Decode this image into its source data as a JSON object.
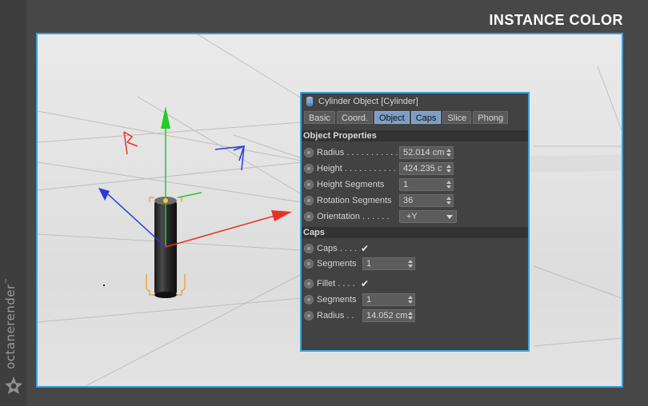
{
  "title": "INSTANCE COLOR",
  "brand": {
    "text": "octanerender",
    "mark": "™"
  },
  "panel": {
    "header": "Cylinder Object [Cylinder]",
    "tabs": [
      {
        "label": "Basic",
        "active": false
      },
      {
        "label": "Coord.",
        "active": false
      },
      {
        "label": "Object",
        "active": true
      },
      {
        "label": "Caps",
        "active": true
      },
      {
        "label": "Slice",
        "active": false
      },
      {
        "label": "Phong",
        "active": false
      }
    ],
    "object_properties": {
      "title": "Object Properties",
      "radius": {
        "label": "Radius . . . . . . . . . . .",
        "value": "52.014 cm"
      },
      "height": {
        "label": "Height . . . . . . . . . . .",
        "value": "424.235 c"
      },
      "height_segments": {
        "label": "Height Segments",
        "value": "1"
      },
      "rotation_segments": {
        "label": "Rotation Segments",
        "value": "36"
      },
      "orientation": {
        "label": "Orientation . . . . . .",
        "value": "+Y"
      }
    },
    "caps": {
      "title": "Caps",
      "caps_toggle": {
        "label": "Caps . . . .",
        "check": "✔"
      },
      "segments": {
        "label": "Segments",
        "value": "1"
      },
      "fillet_toggle": {
        "label": "Fillet . . . .",
        "check": "✔"
      },
      "fillet_segments": {
        "label": "Segments",
        "value": "1"
      },
      "fillet_radius": {
        "label": "Radius . .",
        "value": "14.052 cm"
      }
    }
  },
  "colors": {
    "accent_blue": "#3aa1d8",
    "active_tab": "#7d9dc7",
    "axis_x": "#e8312b",
    "axis_y": "#22cc22",
    "axis_z": "#2a3bd6",
    "selection": "#f09a2a"
  },
  "icons": {
    "cylinder": "cylinder-object-icon",
    "logo": "octane-logo-icon"
  }
}
